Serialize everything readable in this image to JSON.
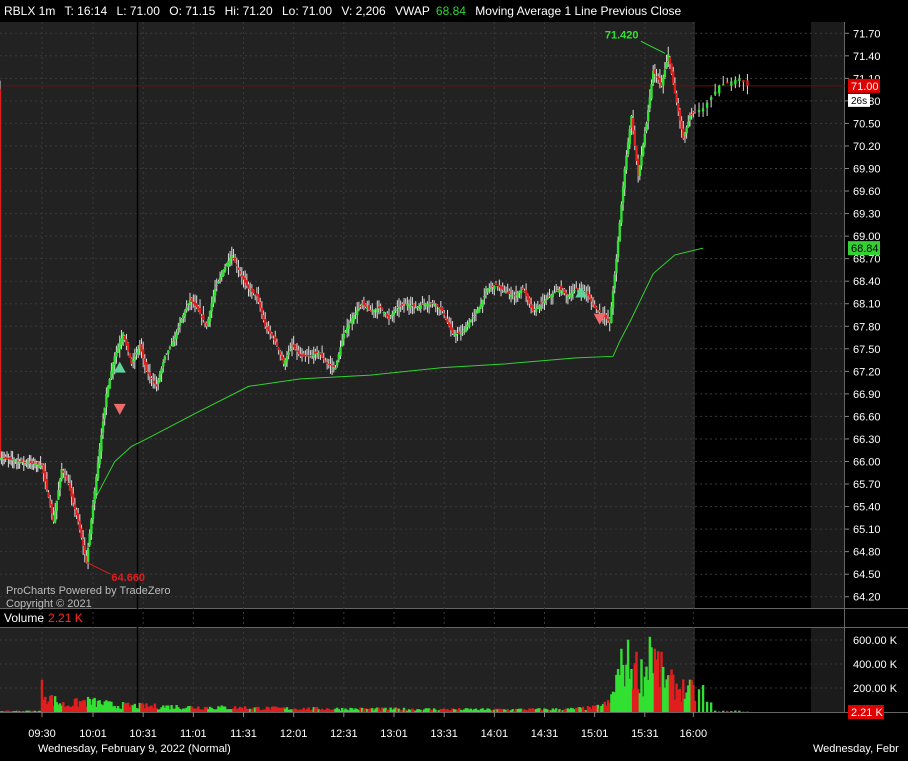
{
  "header": {
    "symbol": "RBLX 1m",
    "time": "T: 16:14",
    "last": "L: 71.00",
    "open": "O: 71.15",
    "high": "Hi: 71.20",
    "low": "Lo: 71.00",
    "volume": "V: 2,206",
    "vwap_label": "VWAP",
    "vwap_value": "68.84",
    "study_labels": "Moving Average 1 Line  Previous Close"
  },
  "watermark": {
    "line1": "ProCharts Powered by TradeZero",
    "line2": "Copyright © 2021"
  },
  "volume_header": {
    "label": "Volume",
    "value": "2.21 K"
  },
  "colors": {
    "up": "#32e032",
    "down": "#e01e1e",
    "vwap": "#32d232",
    "price_tag": "#e00000",
    "background": "#000000",
    "session_bg": "#222222",
    "grid": "#3a3a3a"
  },
  "chart_data": {
    "type": "candlestick",
    "title": "RBLX 1m",
    "y_axis": {
      "ticks": [
        "71.70",
        "71.40",
        "71.10",
        "70.80",
        "70.50",
        "70.20",
        "69.90",
        "69.60",
        "69.30",
        "69.00",
        "68.70",
        "68.40",
        "68.10",
        "67.80",
        "67.50",
        "67.20",
        "66.90",
        "66.60",
        "66.30",
        "66.00",
        "65.70",
        "65.40",
        "65.10",
        "64.80",
        "64.50",
        "64.20"
      ],
      "range": [
        64.05,
        71.85
      ]
    },
    "x_axis": {
      "ticks": [
        "09:30",
        "10:01",
        "10:31",
        "11:01",
        "11:31",
        "12:01",
        "12:31",
        "13:01",
        "13:31",
        "14:01",
        "14:31",
        "15:01",
        "15:31",
        "16:00"
      ],
      "date_label_left": "Wednesday, February 9, 2022 (Normal)",
      "date_label_right": "Wednesday, Febr"
    },
    "current_price": {
      "value": 71.0,
      "label": "71.00",
      "countdown": "26s"
    },
    "vwap_tag": {
      "value": 68.84,
      "label": "68.84"
    },
    "annotations": [
      {
        "label": "71.420",
        "value": 71.42,
        "time": "15:43",
        "kind": "high"
      },
      {
        "label": "64.660",
        "value": 64.66,
        "time": "09:57",
        "kind": "low"
      }
    ],
    "price_path": [
      [
        "04:00",
        66.05
      ],
      [
        "09:30",
        65.95
      ],
      [
        "09:37",
        65.2
      ],
      [
        "09:42",
        65.9
      ],
      [
        "09:46",
        65.7
      ],
      [
        "09:52",
        65.2
      ],
      [
        "09:57",
        64.66
      ],
      [
        "10:03",
        65.8
      ],
      [
        "10:09",
        66.9
      ],
      [
        "10:14",
        67.4
      ],
      [
        "10:19",
        67.7
      ],
      [
        "10:24",
        67.3
      ],
      [
        "10:29",
        67.55
      ],
      [
        "10:33",
        67.2
      ],
      [
        "10:39",
        67.0
      ],
      [
        "10:44",
        67.4
      ],
      [
        "10:49",
        67.6
      ],
      [
        "10:54",
        67.9
      ],
      [
        "10:59",
        68.15
      ],
      [
        "11:03",
        68.05
      ],
      [
        "11:09",
        67.8
      ],
      [
        "11:14",
        68.3
      ],
      [
        "11:19",
        68.55
      ],
      [
        "11:24",
        68.75
      ],
      [
        "11:29",
        68.5
      ],
      [
        "11:34",
        68.3
      ],
      [
        "11:39",
        68.2
      ],
      [
        "11:44",
        67.8
      ],
      [
        "11:50",
        67.6
      ],
      [
        "11:55",
        67.3
      ],
      [
        "12:00",
        67.55
      ],
      [
        "12:05",
        67.4
      ],
      [
        "12:10",
        67.4
      ],
      [
        "12:16",
        67.45
      ],
      [
        "12:21",
        67.3
      ],
      [
        "12:26",
        67.25
      ],
      [
        "12:31",
        67.7
      ],
      [
        "12:37",
        67.95
      ],
      [
        "12:42",
        68.1
      ],
      [
        "12:47",
        68.0
      ],
      [
        "12:53",
        68.05
      ],
      [
        "12:58",
        67.9
      ],
      [
        "13:03",
        68.05
      ],
      [
        "13:09",
        68.1
      ],
      [
        "13:14",
        68.05
      ],
      [
        "13:19",
        68.1
      ],
      [
        "13:25",
        68.1
      ],
      [
        "13:30",
        68.0
      ],
      [
        "13:36",
        67.7
      ],
      [
        "13:41",
        67.7
      ],
      [
        "13:46",
        67.85
      ],
      [
        "13:52",
        68.05
      ],
      [
        "13:57",
        68.3
      ],
      [
        "14:02",
        68.35
      ],
      [
        "14:08",
        68.25
      ],
      [
        "14:13",
        68.2
      ],
      [
        "14:18",
        68.3
      ],
      [
        "14:24",
        68.0
      ],
      [
        "14:29",
        68.1
      ],
      [
        "14:34",
        68.2
      ],
      [
        "14:40",
        68.3
      ],
      [
        "14:45",
        68.2
      ],
      [
        "14:50",
        68.3
      ],
      [
        "14:56",
        68.25
      ],
      [
        "15:01",
        68.05
      ],
      [
        "15:06",
        67.95
      ],
      [
        "15:10",
        67.85
      ],
      [
        "15:14",
        68.7
      ],
      [
        "15:19",
        69.9
      ],
      [
        "15:23",
        70.6
      ],
      [
        "15:27",
        69.8
      ],
      [
        "15:32",
        70.5
      ],
      [
        "15:36",
        71.2
      ],
      [
        "15:41",
        71.0
      ],
      [
        "15:45",
        71.42
      ],
      [
        "15:49",
        70.9
      ],
      [
        "15:54",
        70.3
      ],
      [
        "15:58",
        70.6
      ],
      [
        "16:03",
        70.7
      ],
      [
        "16:07",
        71.0
      ],
      [
        "16:12",
        71.1
      ],
      [
        "16:14",
        71.0
      ]
    ],
    "vwap_path": [
      [
        "10:01",
        65.45
      ],
      [
        "10:14",
        66.0
      ],
      [
        "10:24",
        66.2
      ],
      [
        "10:33",
        66.3
      ],
      [
        "11:03",
        66.65
      ],
      [
        "11:34",
        67.0
      ],
      [
        "12:05",
        67.1
      ],
      [
        "12:47",
        67.15
      ],
      [
        "13:30",
        67.25
      ],
      [
        "14:08",
        67.3
      ],
      [
        "14:50",
        67.38
      ],
      [
        "15:12",
        67.4
      ],
      [
        "15:16",
        67.6
      ],
      [
        "15:23",
        67.9
      ],
      [
        "15:36",
        68.5
      ],
      [
        "15:49",
        68.75
      ],
      [
        "16:03",
        68.84
      ]
    ],
    "signals": [
      {
        "time": "10:17",
        "price": 67.25,
        "kind": "buy"
      },
      {
        "time": "10:17",
        "price": 66.7,
        "kind": "sell"
      },
      {
        "time": "14:53",
        "price": 68.25,
        "kind": "buy"
      },
      {
        "time": "15:04",
        "price": 67.9,
        "kind": "sell"
      }
    ],
    "volume": {
      "y_ticks": [
        "600.00 K",
        "400.00 K",
        "200.00 K"
      ],
      "range_k": [
        0,
        700
      ],
      "current": "2.21 K",
      "profile": [
        [
          "04:00",
          10
        ],
        [
          "09:29",
          10
        ],
        [
          "09:30",
          230
        ],
        [
          "09:36",
          130
        ],
        [
          "09:44",
          70
        ],
        [
          "09:56",
          110
        ],
        [
          "10:01",
          100
        ],
        [
          "10:14",
          70
        ],
        [
          "10:31",
          60
        ],
        [
          "11:01",
          50
        ],
        [
          "12:01",
          35
        ],
        [
          "13:01",
          30
        ],
        [
          "14:01",
          25
        ],
        [
          "14:45",
          28
        ],
        [
          "15:01",
          45
        ],
        [
          "15:10",
          90
        ],
        [
          "15:14",
          330
        ],
        [
          "15:19",
          520
        ],
        [
          "15:27",
          430
        ],
        [
          "15:31",
          350
        ],
        [
          "15:34",
          720
        ],
        [
          "15:38",
          480
        ],
        [
          "15:45",
          300
        ],
        [
          "15:55",
          230
        ],
        [
          "16:03",
          200
        ],
        [
          "16:06",
          10
        ],
        [
          "16:14",
          10
        ]
      ]
    },
    "legend": "none",
    "grid": true
  }
}
